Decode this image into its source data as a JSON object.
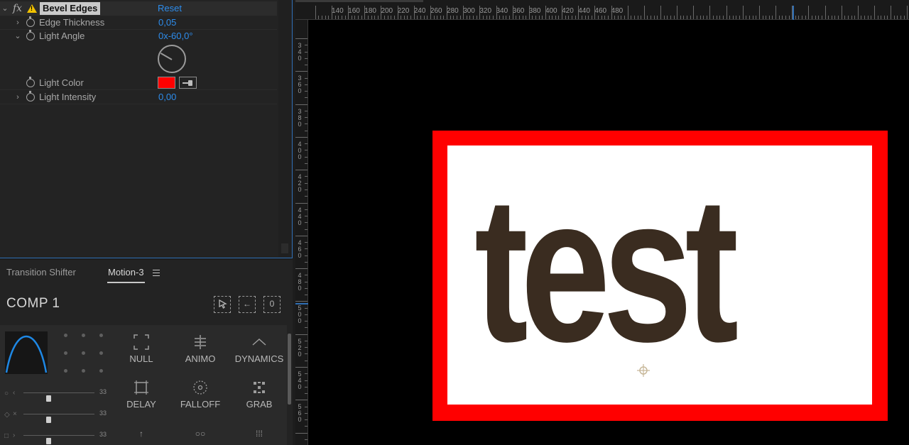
{
  "effect_controls": {
    "effect_name": "Bevel Edges",
    "fx_glyph": "fx",
    "reset_label": "Reset",
    "warning_glyph": "!",
    "properties": [
      {
        "label": "Edge Thickness",
        "value": "0,05"
      },
      {
        "label": "Light Angle",
        "value": "0x-60,0°"
      },
      {
        "label": "Light Color",
        "value": ""
      },
      {
        "label": "Light Intensity",
        "value": "0,00"
      }
    ],
    "light_color_hex": "#ff0000",
    "light_angle_degrees": -60
  },
  "motion_panel": {
    "tabs": [
      {
        "label": "Transition Shifter"
      },
      {
        "label": "Motion-3"
      }
    ],
    "comp_name": "COMP 1",
    "tool_buttons": [
      "select-layers-icon",
      "parent-icon",
      "zero-icon"
    ],
    "zero_glyph": "0",
    "parent_glyph": "←",
    "sliders": [
      {
        "shape": "○",
        "arrow": "‹",
        "value": "33"
      },
      {
        "shape": "◇",
        "arrow": "×",
        "value": "33"
      },
      {
        "shape": "□",
        "arrow": "›",
        "value": "33"
      }
    ],
    "tools": [
      {
        "label": "NULL",
        "icon": "null-icon"
      },
      {
        "label": "ANIMO",
        "icon": "animo-icon"
      },
      {
        "label": "DYNAMICS",
        "icon": "dynamics-icon"
      },
      {
        "label": "DELAY",
        "icon": "delay-icon"
      },
      {
        "label": "FALLOFF",
        "icon": "falloff-icon"
      },
      {
        "label": "GRAB",
        "icon": "grab-icon"
      }
    ],
    "curve_color": "#1e88e5"
  },
  "viewer": {
    "ruler_top_labels": [
      "140",
      "160",
      "180",
      "200",
      "220",
      "240",
      "260",
      "280",
      "300",
      "320",
      "340",
      "360",
      "380",
      "400",
      "420",
      "440",
      "460",
      "480"
    ],
    "ruler_left_labels": [
      "340",
      "360",
      "380",
      "400",
      "420",
      "440",
      "460",
      "480",
      "500",
      "520",
      "540",
      "560"
    ],
    "canvas_text": "test",
    "frame_color": "#ff0000",
    "text_color": "#3a2c20"
  }
}
